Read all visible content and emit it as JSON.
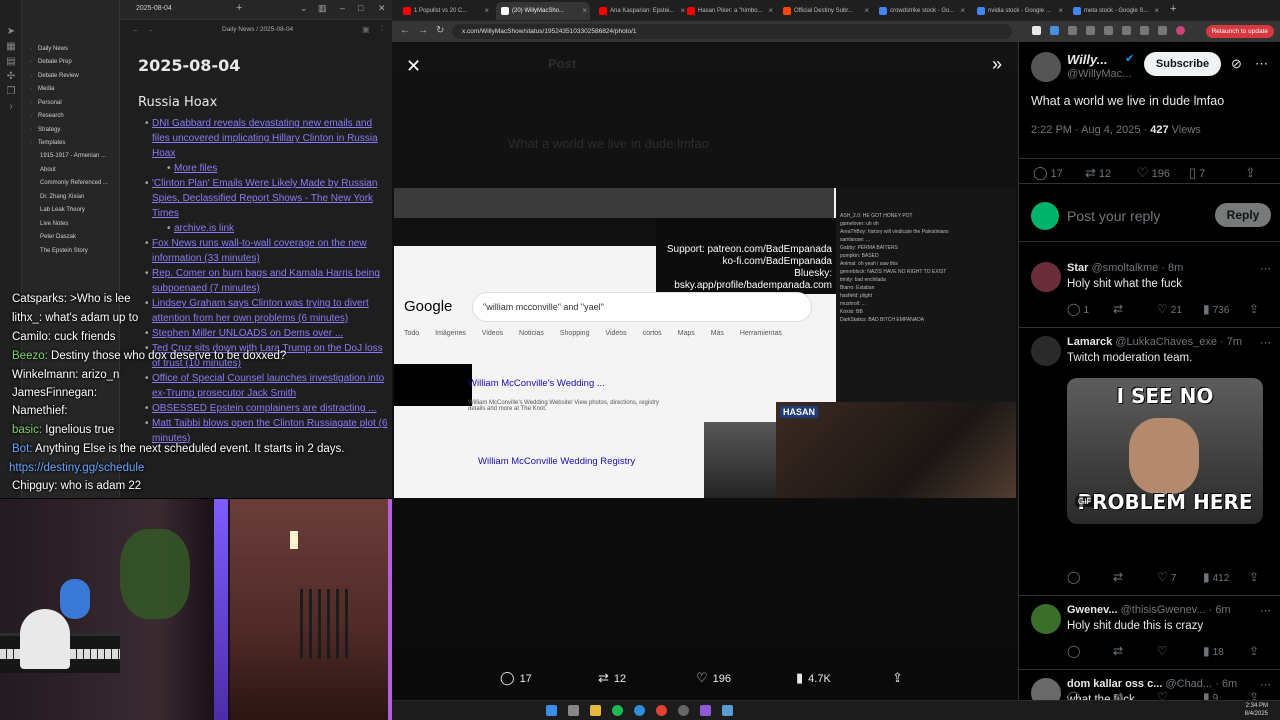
{
  "obsidian": {
    "tab_title": "2025-08-04",
    "breadcrumb": "Daily News / 2025-08-04",
    "folders": [
      "Daily News",
      "Debate Prep",
      "Debate Review",
      "Media",
      "Personal",
      "Research",
      "Strategy",
      "Templates"
    ],
    "files": [
      "1915-1917 - Armenian ...",
      "About",
      "Commonly Referenced ...",
      "Dr. Zhang Xixian",
      "Lab Leak Theory",
      "Live Notes",
      "Peter Daszak",
      "The Epstein Story"
    ],
    "note_date": "2025-08-04",
    "note_heading": "Russia Hoax",
    "links": [
      {
        "text": "DNI Gabbard reveals devastating new emails and files uncovered implicating Hillary Clinton in Russia Hoax",
        "sub": false
      },
      {
        "text": "More files",
        "sub": true
      },
      {
        "text": "'Clinton Plan' Emails Were Likely Made by Russian Spies, Declassified Report Shows - The New York Times",
        "sub": false
      },
      {
        "text": "archive.is link",
        "sub": true
      },
      {
        "text": "Fox News runs wall-to-wall coverage on the new information (33 minutes)",
        "sub": false
      },
      {
        "text": "Rep. Comer on burn bags and Kamala Harris being subpoenaed (7 minutes)",
        "sub": false
      },
      {
        "text": "Lindsey Graham says Clinton was trying to divert attention from her own problems (6 minutes)",
        "sub": false
      },
      {
        "text": "Stephen Miller UNLOADS on Dems over ...",
        "sub": false
      },
      {
        "text": "Ted Cruz sits down with Lara Trump on the DoJ loss of trust (10 minutes)",
        "sub": false
      },
      {
        "text": "Office of Special Counsel launches investigation into ex-Trump prosecutor Jack Smith",
        "sub": false
      },
      {
        "text": "OBSESSED Epstein complainers are distracting ...",
        "sub": false
      },
      {
        "text": "Matt Taibbi blows open the Clinton Russiagate plot (6 minutes)",
        "sub": false
      }
    ]
  },
  "chat": {
    "lines": [
      {
        "user": "Catsparks:",
        "msg": ">Who is lee",
        "user_color": "#ffffff"
      },
      {
        "user": "lithx_:",
        "msg": "what's adam up to",
        "user_color": "#ffffff"
      },
      {
        "user": "Camilo:",
        "msg": "cuck friends",
        "user_color": "#ffffff"
      },
      {
        "user": "Beezo:",
        "msg": "Destiny those who dox deserve to be doxxed?",
        "user_color": "#7fd46a"
      },
      {
        "user": "Winkelmann:",
        "msg": "arizo_n",
        "user_color": "#ffffff"
      },
      {
        "user": "JamesFinnegan:",
        "msg": "",
        "user_color": "#ffffff"
      },
      {
        "user": "Namethief:",
        "msg": "",
        "user_color": "#ffffff"
      },
      {
        "user": "basic:",
        "msg": "Ignelious true",
        "user_color": "#7fd46a"
      },
      {
        "user": "Bot:",
        "msg": "Anything Else is the next scheduled event. It starts in 2 days.",
        "user_color": "#68a6ff"
      },
      {
        "user": "",
        "msg": "https://destiny.gg/schedule",
        "user_color": "#68a6ff"
      },
      {
        "user": "Chipguy:",
        "msg": "who is adam 22",
        "user_color": "#ffffff"
      }
    ]
  },
  "browser": {
    "tabs": [
      {
        "label": "1 Populist vs 20 C...",
        "color": "#ff0000",
        "active": false
      },
      {
        "label": "(20) WillyMacSho...",
        "color": "#ffffff",
        "active": true
      },
      {
        "label": "Ana Kasparian: Epstei...",
        "color": "#ff0000",
        "active": false
      },
      {
        "label": "Hasan Piker: a \"himbo...",
        "color": "#ff0000",
        "active": false
      },
      {
        "label": "Official Destiny Subr...",
        "color": "#ff4500",
        "active": false
      },
      {
        "label": "crowdstrike stock - Go...",
        "color": "#4285f4",
        "active": false
      },
      {
        "label": "nvidia stock - Google ...",
        "color": "#4285f4",
        "active": false
      },
      {
        "label": "meta stock - Google S...",
        "color": "#4285f4",
        "active": false
      }
    ],
    "url": "x.com/WillyMacShow/status/1952435103302586824/photo/1",
    "relaunch_label": "Relaunch to update"
  },
  "viewer": {
    "ghost_title": "Post",
    "ghost_text": "What a world we live in dude lmfao",
    "media": {
      "support_lines": [
        "Support: patreon.com/BadEmpanada",
        "ko-fi.com/BadEmpanada",
        "Bluesky: bsky.app/profile/badempanada.com"
      ],
      "google": "Google",
      "search_query": "\"william mcconville\" and \"yael\"",
      "search_tabs": "Todo Imágenes Videos Noticias Shopping Videos cortos Maps Más Herramientas",
      "result1": "William McConville's Wedding ...",
      "result1_desc": "William McConville's Wedding Website! View photos, directions, registry details and more at The Knot.",
      "result2": "William McConville Wedding Registry",
      "hasan_logo": "HASAN",
      "chat_lines": [
        "ASH_2.0: HE GOT HONEY POT",
        "gamelover: uh oh",
        "AreaThBoy: history will vindicate the Palestinians",
        "samlarose: ...",
        "Gabby: PERMA BAITERS",
        "pumpkin: BASED",
        "Animal: oh yeah i saw this",
        "genreblock: NAZIS HAVE NO RIGHT TO EXIST",
        "trinity: bad enchilada",
        "Biarro: Estaban",
        "hasfield: plight",
        "mushroll: ...",
        "Koxixi: BB",
        "DarkStatics: BAD BITCH EMPANADA"
      ]
    },
    "actions": {
      "replies": "17",
      "reposts": "12",
      "likes": "196",
      "views": "4.7K"
    }
  },
  "tweet": {
    "author_name": "Willy...",
    "author_handle": "@WillyMac...",
    "subscribe_label": "Subscribe",
    "text": "What a world we live in dude lmfao",
    "time": "2:22 PM · Aug 4, 2025 · ",
    "views_count": "427",
    "views_label": " Views",
    "stats": {
      "replies": "17",
      "reposts": "12",
      "likes": "196",
      "bookmarks": "7"
    },
    "reply_placeholder": "Post your reply",
    "reply_button": "Reply"
  },
  "replies": [
    {
      "name": "Star",
      "handle": "@smoltalkme · 8m",
      "text": "Holy shit what the fuck",
      "replies": "1",
      "reposts": "",
      "likes": "21",
      "views": "736",
      "avatar": "#6a2d3a"
    },
    {
      "name": "Lamarck",
      "handle": "@LukkaChaves_exe · 7m",
      "text": "Twitch moderation team.",
      "replies": "",
      "reposts": "",
      "likes": "7",
      "views": "412",
      "avatar": "#2a2a2a",
      "gif_top": "I SEE NO",
      "gif_bottom": "PROBLEM HERE",
      "gif_badge": "GIF"
    },
    {
      "name": "Gwenev...",
      "handle": "@thisisGwenev... · 6m",
      "text": "Holy shit dude this is crazy",
      "replies": "",
      "reposts": "",
      "likes": "",
      "views": "18",
      "avatar": "#3a6d2a"
    },
    {
      "name": "dom kallar oss c...",
      "handle": "@Chad... · 6m",
      "text": "what the fuck",
      "replies": "",
      "reposts": "",
      "likes": "",
      "views": "9",
      "avatar": "#6a6a6a"
    }
  ],
  "taskbar": {
    "time": "2:34 PM",
    "date": "8/4/2025"
  }
}
